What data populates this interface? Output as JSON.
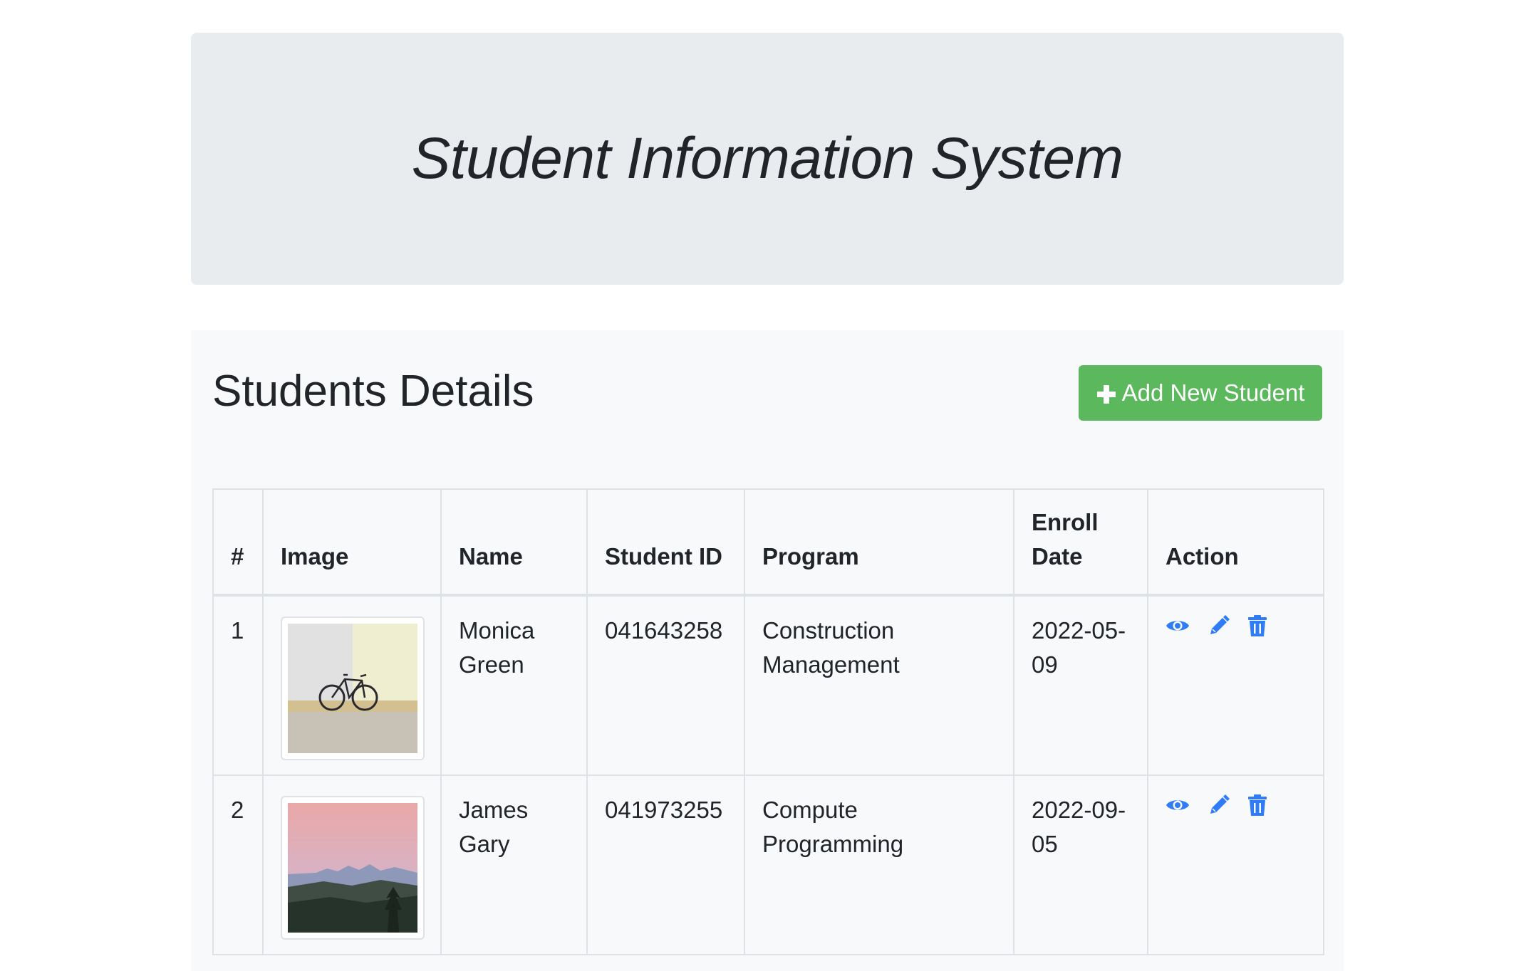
{
  "hero": {
    "title": "Student Information System"
  },
  "panel": {
    "title": "Students Details",
    "add_button_label": "Add New Student"
  },
  "table": {
    "headers": {
      "num": "#",
      "image": "Image",
      "name": "Name",
      "student_id": "Student ID",
      "program": "Program",
      "enroll_date": "Enroll Date",
      "action": "Action"
    },
    "rows": [
      {
        "num": "1",
        "image_icon": "bicycle-photo",
        "name": "Monica Green",
        "student_id": "041643258",
        "program": "Construction Management",
        "enroll_date": "2022-05-09"
      },
      {
        "num": "2",
        "image_icon": "mountain-sunset-photo",
        "name": "James Gary",
        "student_id": "041973255",
        "program": "Compute Programming",
        "enroll_date": "2022-09-05"
      }
    ]
  },
  "icons": {
    "view": "eye-icon",
    "edit": "pencil-icon",
    "delete": "trash-icon",
    "add": "plus-icon"
  },
  "colors": {
    "hero_bg": "#e9ecef",
    "panel_bg": "#f8f9fa",
    "add_button": "#5cb85c",
    "action_icon": "#2f7cf6"
  }
}
